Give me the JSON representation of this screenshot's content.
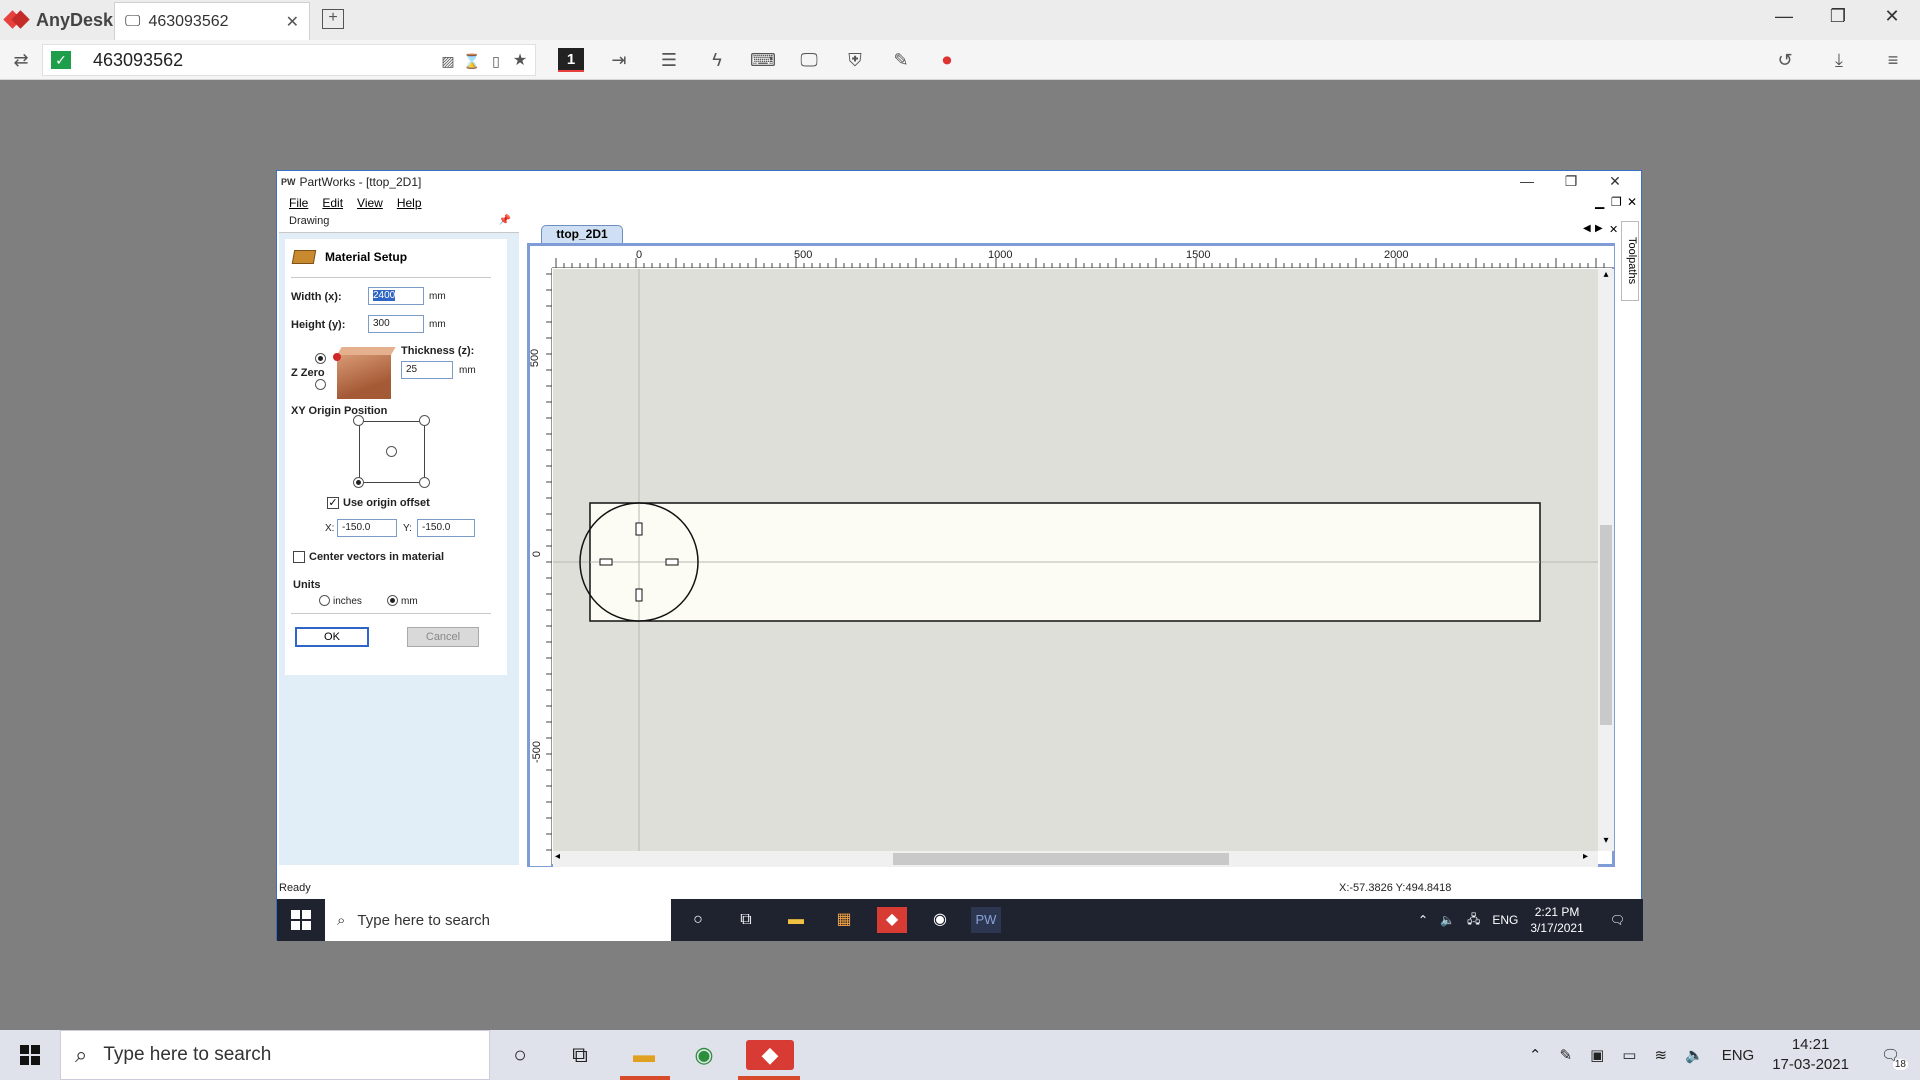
{
  "anydesk": {
    "app_name": "AnyDesk",
    "tab_title": "463093562",
    "address": "463093562",
    "toolbar_display_number": "1"
  },
  "partworks": {
    "window_title": "PartWorks - [ttop_2D1]",
    "logo_text": "PW",
    "menu": [
      "File",
      "Edit",
      "View",
      "Help"
    ],
    "panel_header": "Drawing",
    "material_setup": {
      "title": "Material Setup",
      "width_label": "Width (x):",
      "width_value": "2400",
      "height_label": "Height (y):",
      "height_value": "300",
      "unit": "mm",
      "thickness_label": "Thickness (z):",
      "thickness_value": "25",
      "z_zero_label": "Z Zero",
      "xy_origin_label": "XY Origin Position",
      "use_origin_offset_label": "Use origin offset",
      "use_origin_offset": true,
      "offset_x_label": "X:",
      "offset_x": "-150.0",
      "offset_y_label": "Y:",
      "offset_y": "-150.0",
      "center_vectors_label": "Center vectors in material",
      "center_vectors": false,
      "units_label": "Units",
      "unit_inches": "inches",
      "unit_mm": "mm",
      "selected_unit": "mm",
      "ok_label": "OK",
      "cancel_label": "Cancel"
    },
    "doc_tab": "ttop_2D1",
    "side_tab": "Toolpaths",
    "ruler_h": [
      "0",
      "500",
      "1000",
      "1500",
      "2000"
    ],
    "ruler_v": [
      "500",
      "0",
      "-500"
    ],
    "status_left": "Ready",
    "status_coords": "X:-57.3826 Y:494.8418"
  },
  "inner_taskbar": {
    "search_placeholder": "Type here to search",
    "pw_label": "PW",
    "lang": "ENG",
    "time": "2:21 PM",
    "date": "3/17/2021"
  },
  "taskbar": {
    "search_placeholder": "Type here to search",
    "lang": "ENG",
    "time": "14:21",
    "date": "17-03-2021",
    "notification_count": "18"
  }
}
